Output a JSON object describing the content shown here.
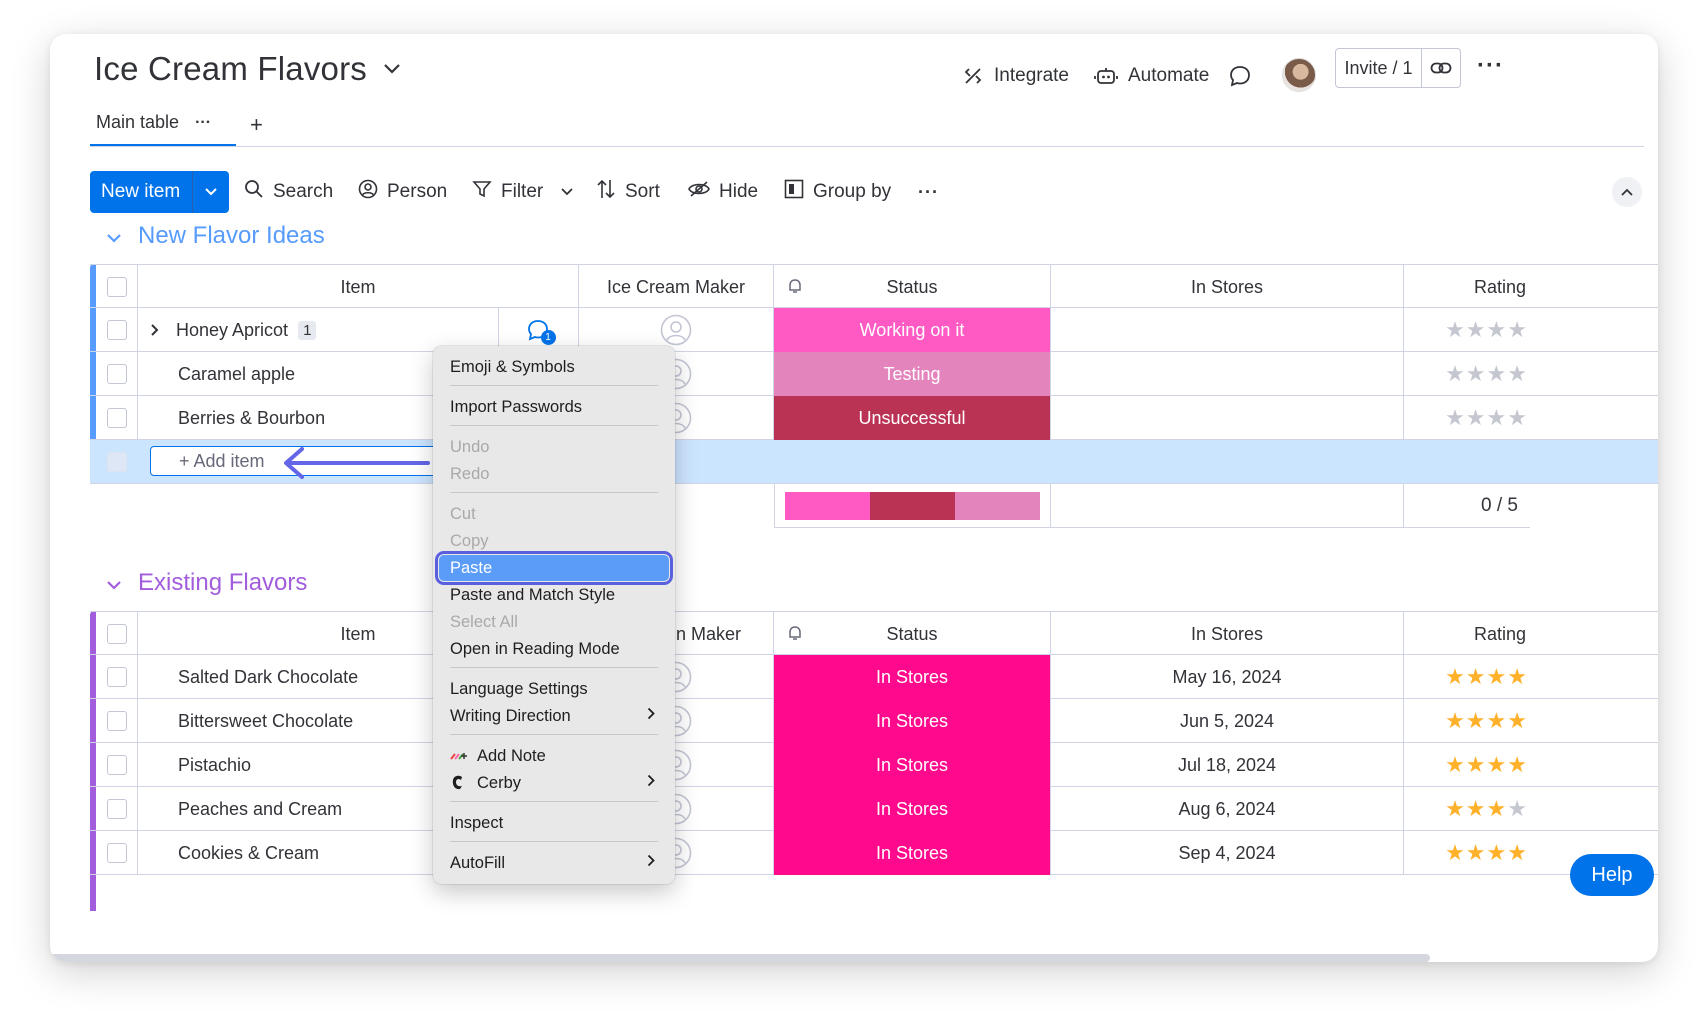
{
  "board": {
    "title": "Ice Cream Flavors",
    "tab_main": "Main table",
    "tab_more": "···",
    "tab_add": "+",
    "integrate": "Integrate",
    "automate": "Automate",
    "invite": "Invite / 1",
    "more": "···"
  },
  "toolbar": {
    "new_item": "New item",
    "search": "Search",
    "person": "Person",
    "filter": "Filter",
    "sort": "Sort",
    "hide": "Hide",
    "group_by": "Group by",
    "more": "···"
  },
  "columns": {
    "item": "Item",
    "maker": "Ice Cream Maker",
    "maker_partial": "n Maker",
    "status": "Status",
    "in_stores": "In Stores",
    "rating": "Rating"
  },
  "group1": {
    "title": "New Flavor Ideas",
    "color": "#579bfc",
    "rows": [
      {
        "item": "Honey Apricot",
        "count": "1",
        "updates": "1",
        "status": "Working on it",
        "status_color": "#ff5ac4",
        "rating": 0
      },
      {
        "item": "Caramel apple",
        "status": "Testing",
        "status_color": "#e484bd",
        "rating": 0
      },
      {
        "item": "Berries & Bourbon",
        "status": "Unsuccessful",
        "status_color": "#bb3354",
        "rating": 0
      }
    ],
    "add_item": "+ Add item",
    "summary_rating": "0 / 5",
    "summary_colors": [
      "#ff5ac4",
      "#bb3354",
      "#e484bd"
    ]
  },
  "group2": {
    "title": "Existing Flavors",
    "color": "#a25ddc",
    "rows": [
      {
        "item": "Salted Dark Chocolate",
        "status": "In Stores",
        "date": "May 16, 2024",
        "rating": 4
      },
      {
        "item": "Bittersweet Chocolate",
        "status": "In Stores",
        "date": "Jun 5, 2024",
        "rating": 4
      },
      {
        "item": "Pistachio",
        "status": "In Stores",
        "date": "Jul 18, 2024",
        "rating": 4
      },
      {
        "item": "Peaches and Cream",
        "status": "In Stores",
        "date": "Aug 6, 2024",
        "rating": 3
      },
      {
        "item": "Cookies & Cream",
        "status": "In Stores",
        "date": "Sep 4, 2024",
        "rating": 4
      }
    ],
    "status_color": "#ff0a8c"
  },
  "context_menu": {
    "emoji": "Emoji & Symbols",
    "import_passwords": "Import Passwords",
    "undo": "Undo",
    "redo": "Redo",
    "cut": "Cut",
    "copy": "Copy",
    "paste": "Paste",
    "paste_match": "Paste and Match Style",
    "select_all": "Select All",
    "reading_mode": "Open in Reading Mode",
    "language": "Language Settings",
    "writing_direction": "Writing Direction",
    "add_note": "Add Note",
    "cerby": "Cerby",
    "inspect": "Inspect",
    "autofill": "AutoFill"
  },
  "help": "Help",
  "colors": {
    "accent": "#0073ea",
    "star_on": "#ffb12b",
    "star_off": "#c5c7d0",
    "paste_highlight": "#5a9cf8",
    "paste_outline": "#5a5fe0",
    "selected_row": "#cce5ff"
  }
}
